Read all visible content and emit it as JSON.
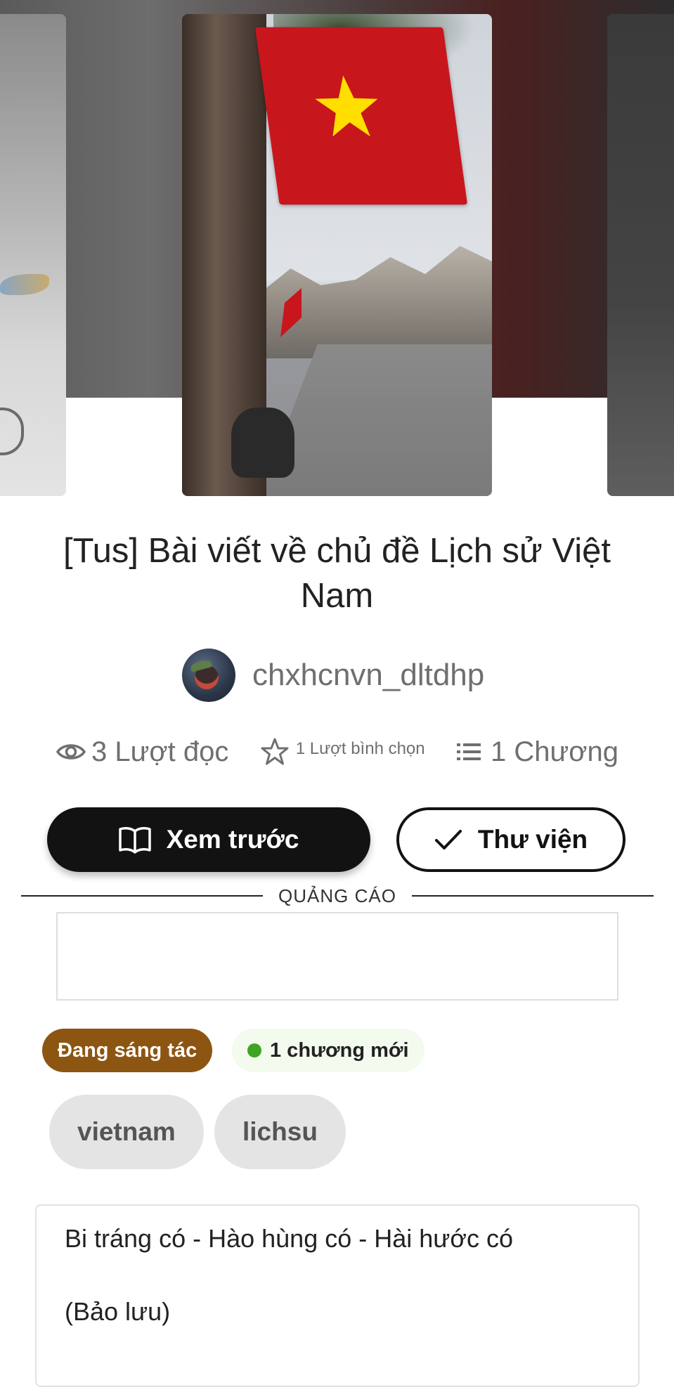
{
  "story": {
    "title": "[Tus] Bài viết về chủ đề Lịch sử Việt Nam",
    "author": "chxhcnvn_dltdhp"
  },
  "stats": {
    "reads": "3 Lượt đọc",
    "votes": "1 Lượt bình chọn",
    "chapters": "1 Chương"
  },
  "actions": {
    "preview_label": "Xem trước",
    "library_label": "Thư viện"
  },
  "ad": {
    "label": "QUẢNG CÁO"
  },
  "status": {
    "badge": "Đang sáng tác",
    "new_chapters": "1 chương mới"
  },
  "tags": [
    "vietnam",
    "lichsu"
  ],
  "description": {
    "lines": [
      "Bi tráng có - Hào hùng có - Hài hước có",
      "(Bảo lưu)"
    ]
  },
  "icons": {
    "reads": "eye-icon",
    "votes": "star-icon",
    "chapters": "list-icon",
    "preview": "open-book-icon",
    "library": "checkmark-icon"
  },
  "colors": {
    "primary_button": "#121212",
    "status_badge": "#8c5512",
    "new_dot": "#3ea424",
    "tag_bg": "#e4e4e4"
  }
}
